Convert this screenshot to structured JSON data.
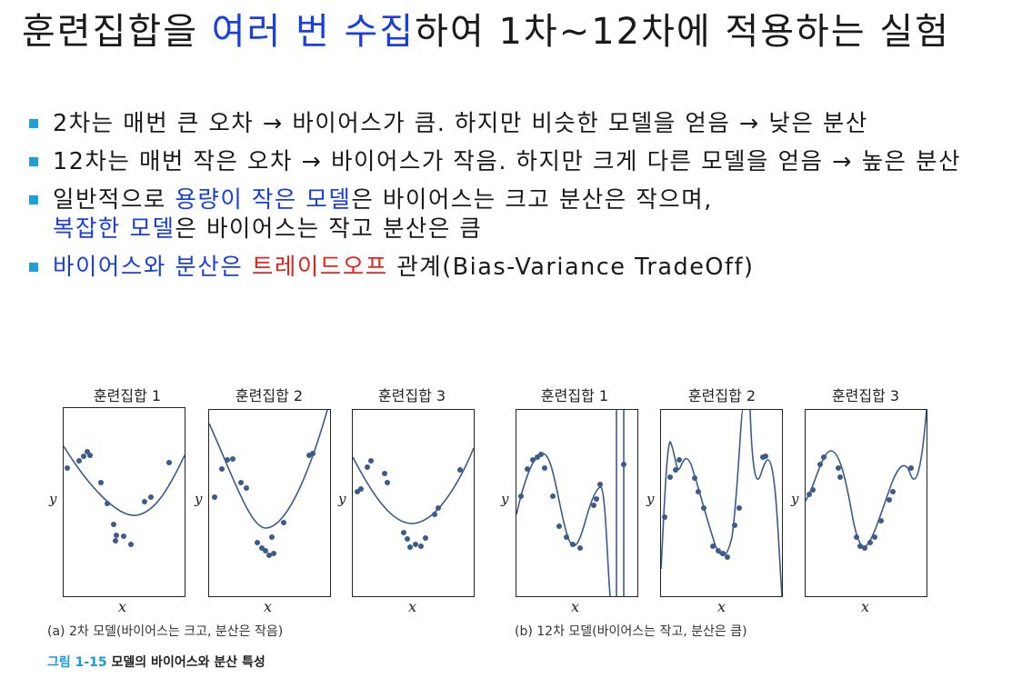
{
  "title": {
    "part1": "훈련집합을 ",
    "part2_highlight": "여러 번 수집",
    "part3": "하여 1차~12차에 적용하는 실험"
  },
  "bullets": [
    {
      "text": "2차는 매번 큰 오차 → 바이어스가 큼. 하지만 비슷한 모델을 얻음 → 낮은 분산"
    },
    {
      "text": "12차는 매번 작은 오차 → 바이어스가 작음. 하지만 크게 다른 모델을 얻음 → 높은 분산"
    },
    {
      "seg1": "일반적으로 ",
      "seg2_highlight": "용량이 작은 모델",
      "seg3": "은 바이어스는 크고 분산은 작으며,",
      "seg4_highlight": "복잡한 모델",
      "seg5": "은 바이어스는 작고 분산은 큼"
    },
    {
      "seg1_highlight": "바이어스와 분산은 ",
      "seg2_red": "트레이드오프",
      "seg3": " 관계(Bias-Variance TradeOff)"
    }
  ],
  "figure": {
    "panel_titles": [
      "훈련집합 1",
      "훈련집합 2",
      "훈련집합 3",
      "훈련집합 1",
      "훈련집합 2",
      "훈련집합 3"
    ],
    "y_axis_label": "y",
    "x_axis_label": "x",
    "caption_a": "(a) 2차 모델(바이어스는 크고, 분산은 작음)",
    "caption_b": "(b) 12차 모델(바이어스는 작고, 분산은 큼)",
    "figure_number": "그림 1-15",
    "figure_title": "모델의 바이어스와 분산 특성"
  },
  "colors": {
    "accent_blue": "#1a3fe0",
    "accent_red": "#e8231c",
    "bullet": "#1ea0d6",
    "plot": "#3b5b8c"
  }
}
